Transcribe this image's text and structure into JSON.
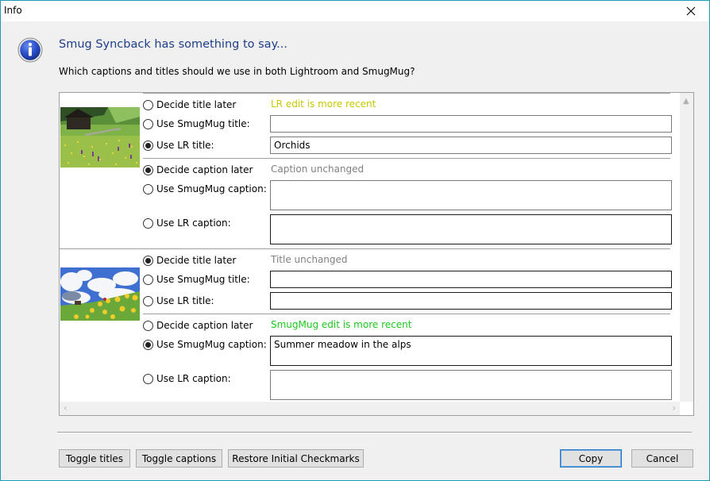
{
  "window": {
    "title": "Info",
    "close_icon": "close-x-icon"
  },
  "header": {
    "icon": "info-icon",
    "heading": "Smug Syncback has something to say...",
    "question": "Which captions and titles should we use in both Lightroom and SmugMug?"
  },
  "items": [
    {
      "thumbnail": "alpine-meadow-with-hut",
      "title_section": {
        "status": "LR edit is more recent",
        "status_color": "#c8c800",
        "options": [
          {
            "label": "Decide title later",
            "checked": false
          },
          {
            "label": "Use SmugMug title:",
            "checked": false,
            "value": ""
          },
          {
            "label": "Use LR title:",
            "checked": true,
            "value": "Orchids"
          }
        ]
      },
      "caption_section": {
        "status": "Caption unchanged",
        "status_color": "#808080",
        "options": [
          {
            "label": "Decide caption later",
            "checked": true
          },
          {
            "label": "Use SmugMug caption:",
            "checked": false,
            "value": ""
          },
          {
            "label": "Use LR caption:",
            "checked": false,
            "value": ""
          }
        ]
      }
    },
    {
      "thumbnail": "summer-meadow-sky-clouds",
      "title_section": {
        "status": "Title unchanged",
        "status_color": "#808080",
        "options": [
          {
            "label": "Decide title later",
            "checked": true
          },
          {
            "label": "Use SmugMug title:",
            "checked": false,
            "value": ""
          },
          {
            "label": "Use LR title:",
            "checked": false,
            "value": ""
          }
        ]
      },
      "caption_section": {
        "status": "SmugMug edit is more recent",
        "status_color": "#1ec81e",
        "options": [
          {
            "label": "Decide caption later",
            "checked": false
          },
          {
            "label": "Use SmugMug caption:",
            "checked": true,
            "value": "Summer meadow in the alps"
          },
          {
            "label": "Use LR caption:",
            "checked": false,
            "value": ""
          }
        ]
      }
    }
  ],
  "buttons": {
    "toggle_titles": "Toggle titles",
    "toggle_captions": "Toggle captions",
    "restore": "Restore Initial Checkmarks",
    "copy": "Copy",
    "cancel": "Cancel"
  },
  "colors": {
    "window_border": "#1a9bb5",
    "heading": "#1e3f8a",
    "default_button_border": "#2d7bc7"
  }
}
